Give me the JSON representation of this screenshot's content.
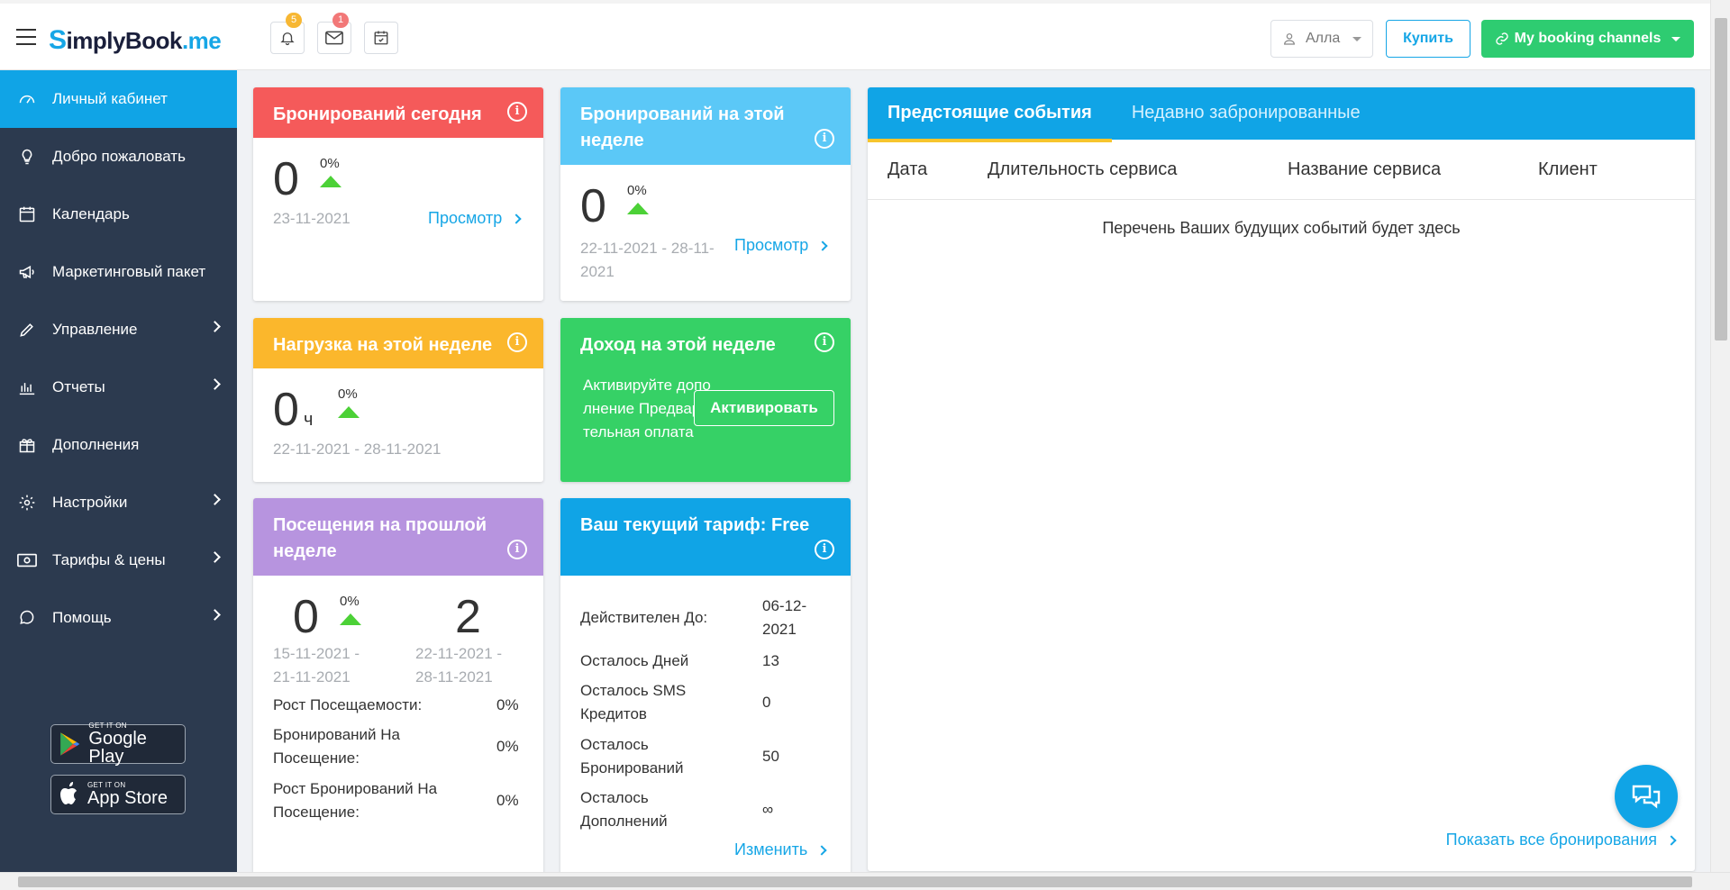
{
  "header": {
    "logo_s": "S",
    "logo_main": "implyBook",
    "logo_me": ".me",
    "notifications_count": "5",
    "messages_count": "1",
    "user_name": "Алла",
    "buy_label": "Купить",
    "channels_label": "My booking channels"
  },
  "sidebar": {
    "items": [
      {
        "label": "Личный кабинет"
      },
      {
        "label": "Добро пожаловать"
      },
      {
        "label": "Календарь"
      },
      {
        "label": "Маркетинговый пакет"
      },
      {
        "label": "Управление"
      },
      {
        "label": "Отчеты"
      },
      {
        "label": "Дополнения"
      },
      {
        "label": "Настройки"
      },
      {
        "label": "Тарифы & цены"
      },
      {
        "label": "Помощь"
      }
    ],
    "google_play": {
      "small": "GET IT ON",
      "big": "Google Play"
    },
    "app_store": {
      "small": "GET IT ON",
      "big": "App Store"
    }
  },
  "cards": {
    "today": {
      "title": "Бронирований сегодня",
      "value": "0",
      "pct": "0%",
      "date": "23-11-2021",
      "link": "Просмотр",
      "color": "#f55a5a"
    },
    "week": {
      "title": "Бронирований на этой неделе",
      "value": "0",
      "pct": "0%",
      "date": "22-11-2021 - 28-11-2021",
      "link": "Просмотр",
      "color": "#5bc8f7"
    },
    "load": {
      "title": "Нагрузка на этой неделе",
      "value": "0",
      "unit": "ч",
      "pct": "0%",
      "date": "22-11-2021 - 28-11-2021",
      "color": "#fbb72c"
    },
    "income": {
      "title": "Доход на этой неделе",
      "text": "Активируйте дополнение Предварительная оплата",
      "button": "Активировать",
      "color": "#36d166"
    },
    "visits": {
      "title": "Посещения на прошлой неделе",
      "prev_value": "0",
      "pct": "0%",
      "curr_value": "2",
      "prev_date": "15-11-2021 - 21-11-2021",
      "curr_date": "22-11-2021 - 28-11-2021",
      "rows": [
        {
          "label": "Рост Посещаемости:",
          "value": "0%"
        },
        {
          "label": "Бронирований На Посещение:",
          "value": "0%"
        },
        {
          "label": "Рост Бронирований На Посещение:",
          "value": "0%"
        }
      ],
      "color": "#b794df"
    },
    "plan": {
      "title": "Ваш текущий тариф: Free",
      "rows": [
        {
          "label": "Действителен До:",
          "value": "06-12-2021"
        },
        {
          "label": "Осталось Дней",
          "value": "13"
        },
        {
          "label": "Осталось SMS Кредитов",
          "value": "0"
        },
        {
          "label": "Осталось Бронирований",
          "value": "50"
        },
        {
          "label": "Осталось Дополнений",
          "value": "∞"
        }
      ],
      "link": "Изменить",
      "color": "#10a4e6"
    }
  },
  "events": {
    "tabs": [
      "Предстоящие события",
      "Недавно забронированные"
    ],
    "columns": [
      "Дата",
      "Длительность сервиса",
      "Название сервиса",
      "Клиент"
    ],
    "empty": "Перечень Ваших будущих событий будет здесь",
    "show_all": "Показать все бронирования"
  }
}
